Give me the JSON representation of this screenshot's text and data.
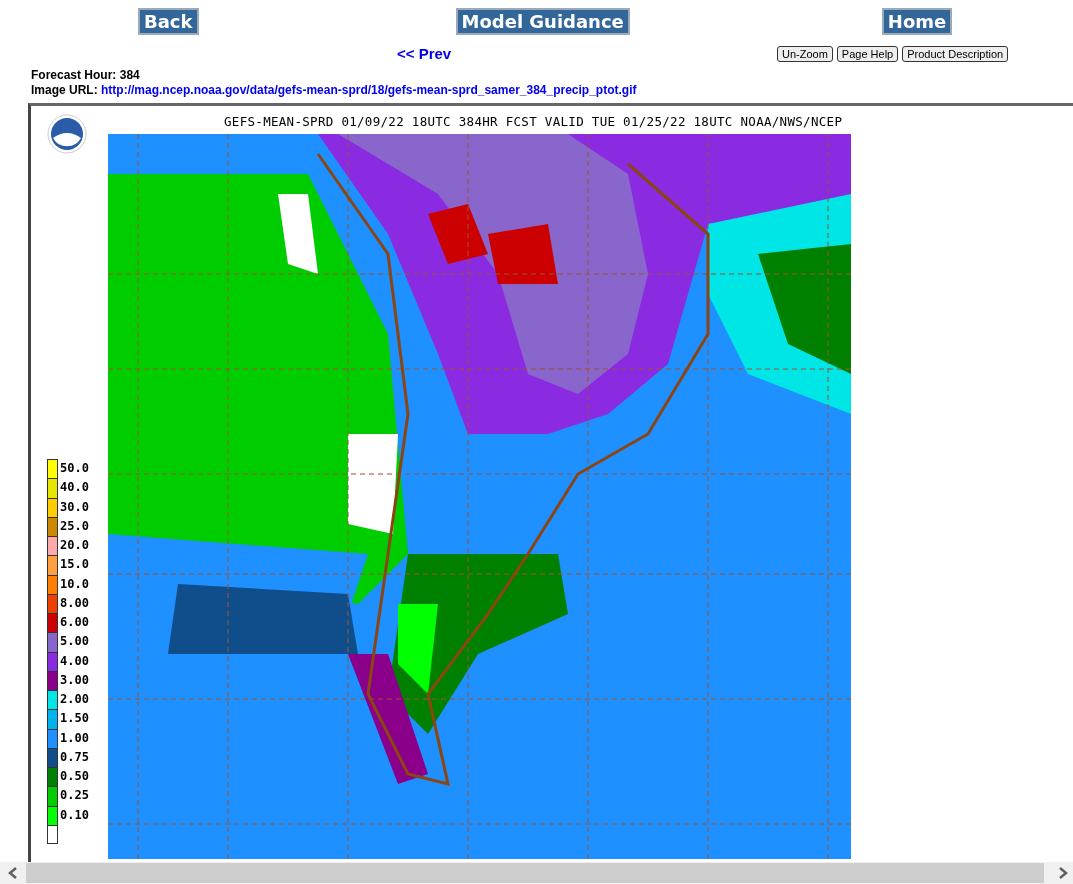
{
  "nav_buttons": [
    "Back",
    "Model Guidance",
    "Home"
  ],
  "prev_link": "<< Prev",
  "tool_buttons": [
    "Un-Zoom",
    "Page Help",
    "Product Description"
  ],
  "forecast_hour": {
    "label": "Forecast Hour:",
    "value": "384"
  },
  "image_url": {
    "label": "Image URL:",
    "value": "http://mag.ncep.noaa.gov/data/gefs-mean-sprd/18/gefs-mean-sprd_samer_384_precip_ptot.gif"
  },
  "map": {
    "title": "GEFS-MEAN-SPRD 01/09/22 18UTC 384HR FCST VALID TUE 01/25/22 18UTC NOAA/NWS/NCEP",
    "legend": [
      {
        "label": "50.0",
        "color": "#ffff00"
      },
      {
        "label": "40.0",
        "color": "#e6e600"
      },
      {
        "label": "30.0",
        "color": "#ffcc00"
      },
      {
        "label": "25.0",
        "color": "#cc8800"
      },
      {
        "label": "20.0",
        "color": "#ffaaaa"
      },
      {
        "label": "15.0",
        "color": "#ffa040"
      },
      {
        "label": "10.0",
        "color": "#ff7f00"
      },
      {
        "label": "8.00",
        "color": "#ee4000"
      },
      {
        "label": "6.00",
        "color": "#cc0000"
      },
      {
        "label": "5.00",
        "color": "#8866cc"
      },
      {
        "label": "4.00",
        "color": "#8a2be2"
      },
      {
        "label": "3.00",
        "color": "#8b008b"
      },
      {
        "label": "2.00",
        "color": "#00e5e5"
      },
      {
        "label": "1.50",
        "color": "#00b2ee"
      },
      {
        "label": "1.00",
        "color": "#1e90ff"
      },
      {
        "label": "0.75",
        "color": "#104e8b"
      },
      {
        "label": "0.50",
        "color": "#008000"
      },
      {
        "label": "0.25",
        "color": "#00cd00"
      },
      {
        "label": "0.10",
        "color": "#00ff00"
      },
      {
        "color": "#ffffff"
      }
    ]
  }
}
